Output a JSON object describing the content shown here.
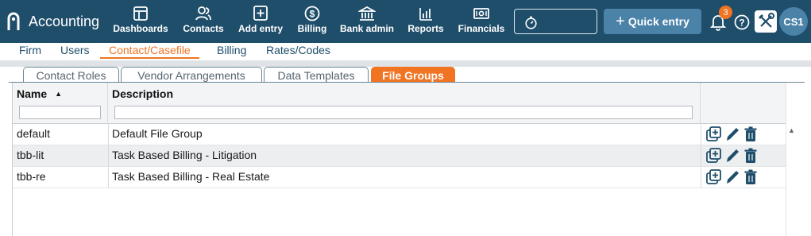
{
  "app": {
    "name": "Accounting"
  },
  "nav": [
    {
      "id": "dashboards",
      "label": "Dashboards",
      "icon": "dashboard-icon"
    },
    {
      "id": "contacts",
      "label": "Contacts",
      "icon": "contacts-icon"
    },
    {
      "id": "add_entry",
      "label": "Add entry",
      "icon": "add-entry-icon"
    },
    {
      "id": "billing",
      "label": "Billing",
      "icon": "dollar-icon"
    },
    {
      "id": "bank_admin",
      "label": "Bank admin",
      "icon": "bank-icon"
    },
    {
      "id": "reports",
      "label": "Reports",
      "icon": "bar-chart-icon"
    },
    {
      "id": "financials",
      "label": "Financials",
      "icon": "cash-icon"
    }
  ],
  "header": {
    "quick_entry_label": "Quick entry",
    "notification_count": "3",
    "avatar_initials": "CS1"
  },
  "subnav": [
    {
      "label": "Firm",
      "active": false
    },
    {
      "label": "Users",
      "active": false
    },
    {
      "label": "Contact/Casefile",
      "active": true
    },
    {
      "label": "Billing",
      "active": false
    },
    {
      "label": "Rates/Codes",
      "active": false
    }
  ],
  "tabs": [
    {
      "label": "Contact Roles",
      "active": false
    },
    {
      "label": "Vendor Arrangements",
      "active": false
    },
    {
      "label": "Data Templates",
      "active": false
    },
    {
      "label": "File Groups",
      "active": true
    }
  ],
  "table": {
    "columns": [
      {
        "label": "Name",
        "sort": "ascending"
      },
      {
        "label": "Description"
      }
    ],
    "rows": [
      {
        "name": "default",
        "description": "Default File Group"
      },
      {
        "name": "tbb-lit",
        "description": "Task Based Billing - Litigation"
      },
      {
        "name": "tbb-re",
        "description": "Task Based Billing - Real Estate"
      }
    ]
  },
  "colors": {
    "topbar": "#1f4e6b",
    "accent": "#f07422",
    "button": "#4a82a8",
    "row_alt": "#eceef0"
  }
}
